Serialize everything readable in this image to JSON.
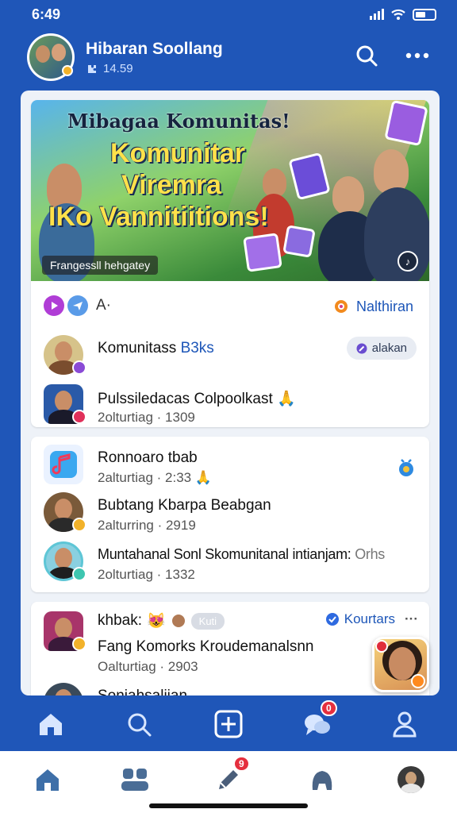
{
  "status_bar": {
    "time": "6:49"
  },
  "header": {
    "title": "Hibaran Soollang",
    "subtitle": "14.59",
    "search_icon": "search-icon",
    "more_icon": "more-horizontal-icon"
  },
  "banner": {
    "line1": "Mibagaa Komunitas!",
    "line2": "Komunitar",
    "line3": "Viremra",
    "line4": "IKo Vannitiitions!",
    "caption": "Frangessll hehgatey",
    "play_icon": "music-note-icon"
  },
  "action_bar": {
    "more_label": "A·",
    "right_label": "Nalthiran",
    "right_icon": "gear-icon"
  },
  "card1": {
    "rows": [
      {
        "name": "Komunitass",
        "name_accent": "B3ks",
        "meta": "",
        "pill": "alakan"
      },
      {
        "name": "Pulssiledacas Colpoolkast",
        "meta": "2olturtiag · 1309"
      }
    ]
  },
  "card2": {
    "rows": [
      {
        "name": "Ronnoaro tbab",
        "meta": "2alturtiag · 2:33"
      },
      {
        "name": "Bubtang Kbarpa Beabgan",
        "meta": "2alturring · 2919"
      },
      {
        "name": "Muntahanal Sonl Skomunitanal intianjam:",
        "name_tail": "Orhs",
        "meta": "2olturtiag · 1332"
      }
    ]
  },
  "card3": {
    "header_name": "khbak:",
    "header_chip": "Kuti",
    "header_right": "Kourtars",
    "rows": [
      {
        "name": "Fang Komorks Kroudemanalsnn",
        "meta": "Oalturtiag · 2903"
      },
      {
        "name": "Soniahsaliian",
        "meta": ""
      }
    ]
  },
  "tabbar_top": {
    "items": [
      "home-icon",
      "search-icon",
      "add-square-icon",
      "chat-bubbles-icon",
      "profile-icon"
    ],
    "chat_badge": "0"
  },
  "tabbar_bottom": {
    "items": [
      "home-icon",
      "groups-icon",
      "pen-icon",
      "gamepad-icon",
      "avatar"
    ],
    "pen_badge": "9"
  },
  "colors": {
    "primary": "#1f56b8",
    "accent_yellow": "#ffe14a",
    "badge_red": "#e52f3e",
    "card_bg": "#ffffff",
    "feed_bg": "#eef2f8"
  }
}
